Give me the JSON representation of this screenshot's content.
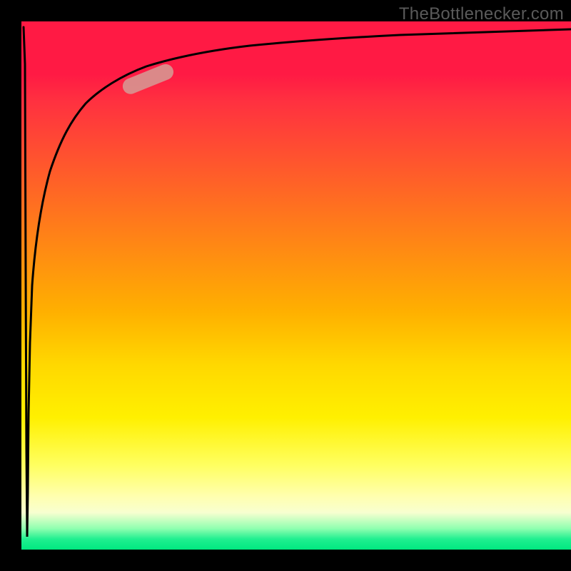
{
  "watermark": "TheBottlenecker.com",
  "chart_data": {
    "type": "line",
    "title": "",
    "xlabel": "",
    "ylabel": "",
    "xlim": [
      0,
      100
    ],
    "ylim": [
      0,
      100
    ],
    "x": [
      0,
      0.5,
      1,
      1.5,
      2,
      3,
      4,
      5,
      7,
      10,
      15,
      20,
      25,
      30,
      40,
      50,
      60,
      70,
      80,
      90,
      100
    ],
    "values": [
      100,
      50,
      2,
      30,
      50,
      64,
      72,
      77,
      82,
      86,
      89,
      91,
      92.5,
      93.2,
      94.3,
      95,
      95.5,
      95.9,
      96.2,
      96.5,
      96.8
    ],
    "gradient_stops": [
      {
        "pos": 0,
        "color": "#ff1a44"
      },
      {
        "pos": 50,
        "color": "#ffb000"
      },
      {
        "pos": 85,
        "color": "#ffff60"
      },
      {
        "pos": 100,
        "color": "#00e880"
      }
    ],
    "marker": {
      "type": "pill",
      "color": "#d8928f",
      "x_center": 22,
      "y_center": 89.5,
      "length": 9
    }
  }
}
